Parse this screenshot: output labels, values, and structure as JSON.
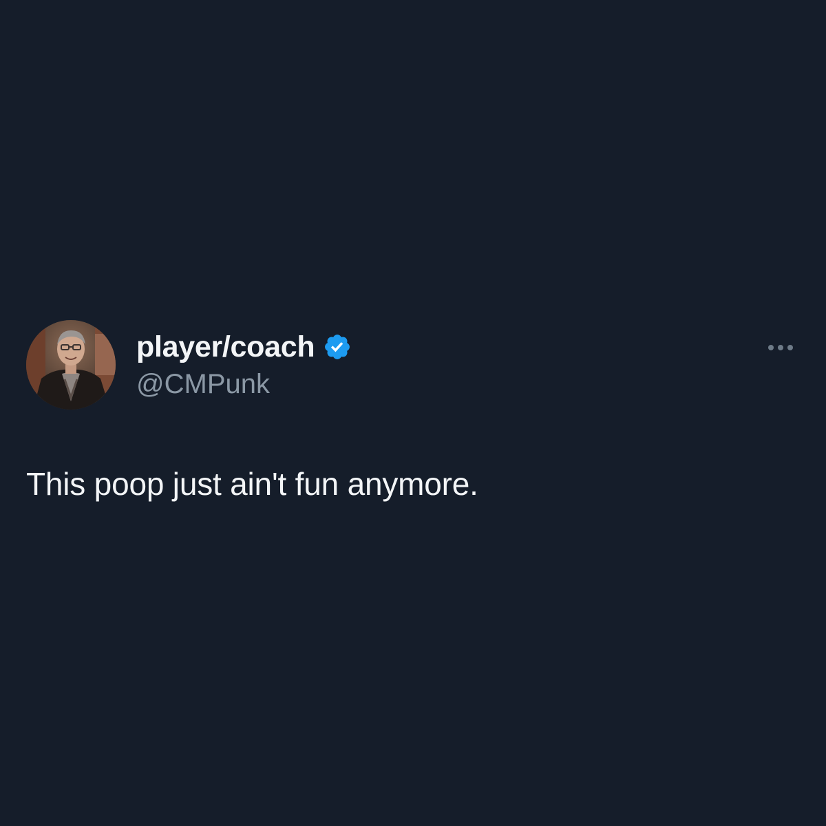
{
  "tweet": {
    "author": {
      "display_name": "player/coach",
      "handle": "@CMPunk",
      "verified": true,
      "avatar": "profile-photo"
    },
    "text": "This poop just ain't fun anymore.",
    "more_icon": "more-horizontal-icon"
  },
  "colors": {
    "background": "#151d2a",
    "primary_text": "#f3f5f7",
    "secondary_text": "#8b98a5",
    "verified_badge": "#1d9bf0"
  }
}
